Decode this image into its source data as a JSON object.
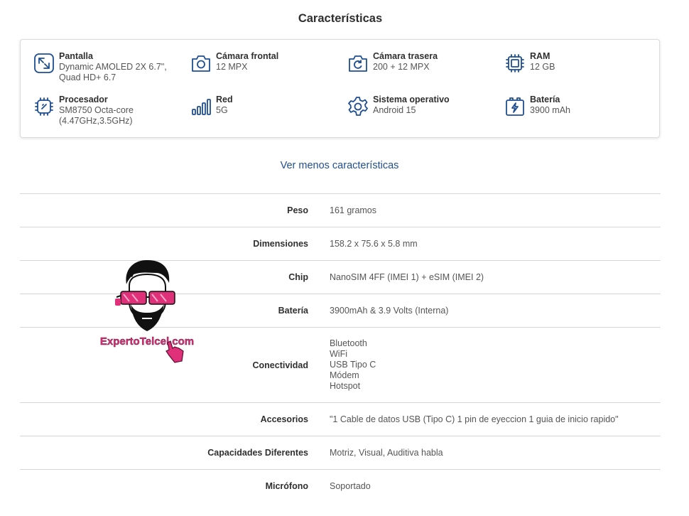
{
  "header": {
    "title": "Características"
  },
  "features": [
    {
      "icon": "expand-arrows-icon",
      "label": "Pantalla",
      "value": "Dynamic AMOLED 2X 6.7\", Quad HD+ 6.7"
    },
    {
      "icon": "front-camera-icon",
      "label": "Cámara frontal",
      "value": "12 MPX"
    },
    {
      "icon": "rear-camera-icon",
      "label": "Cámara trasera",
      "value": "200 + 12 MPX"
    },
    {
      "icon": "ram-chip-icon",
      "label": "RAM",
      "value": "12 GB"
    },
    {
      "icon": "processor-icon",
      "label": "Procesador",
      "value": "SM8750 Octa-core (4.47GHz,3.5GHz)"
    },
    {
      "icon": "signal-bars-icon",
      "label": "Red",
      "value": "5G"
    },
    {
      "icon": "gear-icon",
      "label": "Sistema operativo",
      "value": "Android 15"
    },
    {
      "icon": "battery-bolt-icon",
      "label": "Batería",
      "value": "3900 mAh"
    }
  ],
  "toggle": {
    "label": "Ver menos características"
  },
  "specs": [
    {
      "key": "Peso",
      "value": "161 gramos"
    },
    {
      "key": "Dimensiones",
      "value": "158.2 x 75.6 x 5.8 mm"
    },
    {
      "key": "Chip",
      "value": "NanoSIM 4FF (IMEI 1) + eSIM (IMEI 2)"
    },
    {
      "key": "Batería",
      "value": "3900mAh & 3.9 Volts (Interna)"
    },
    {
      "key": "Conectividad",
      "values": [
        "Bluetooth",
        "WiFi",
        "USB Tipo C",
        "Módem",
        "Hotspot"
      ]
    },
    {
      "key": "Accesorios",
      "value": "\"1 Cable de datos USB (Tipo C) 1 pin de eyeccion 1 guia de inicio rapido\""
    },
    {
      "key": "Capacidades Diferentes",
      "value": "Motriz, Visual, Auditiva habla"
    },
    {
      "key": "Micrófono",
      "value": "Soportado"
    }
  ],
  "watermark": {
    "text": "ExpertoTelcel.com"
  },
  "colors": {
    "accent": "#1f4e93",
    "icon": "#1f4e93",
    "watermark": "#e0307a"
  }
}
